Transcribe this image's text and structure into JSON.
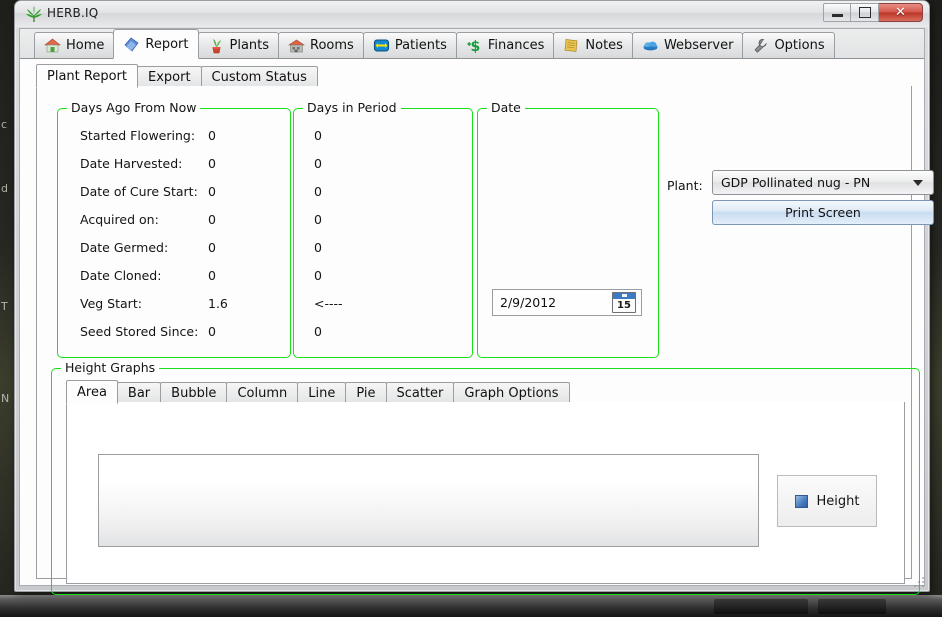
{
  "window": {
    "title": "HERB.IQ",
    "app_icon": "cannabis-leaf-icon",
    "minimize_label": "Minimize",
    "maximize_label": "Maximize",
    "close_label": "Close"
  },
  "desktop": {
    "ghost_text": [
      "c",
      "d",
      "T",
      "N"
    ]
  },
  "main_tabs": [
    {
      "label": "Home",
      "icon": "house-icon",
      "active": false
    },
    {
      "label": "Report",
      "icon": "report-icon",
      "active": true
    },
    {
      "label": "Plants",
      "icon": "plant-pot-icon",
      "active": false
    },
    {
      "label": "Rooms",
      "icon": "building-icon",
      "active": false
    },
    {
      "label": "Patients",
      "icon": "patients-icon",
      "active": false
    },
    {
      "label": "Finances",
      "icon": "dollar-icon",
      "active": false
    },
    {
      "label": "Notes",
      "icon": "notebook-icon",
      "active": false
    },
    {
      "label": "Webserver",
      "icon": "cloud-icon",
      "active": false
    },
    {
      "label": "Options",
      "icon": "wrench-icon",
      "active": false
    }
  ],
  "sub_tabs": [
    {
      "label": "Plant Report",
      "active": true
    },
    {
      "label": "Export",
      "active": false
    },
    {
      "label": "Custom Status",
      "active": false
    }
  ],
  "days_ago_group": {
    "title": "Days Ago From Now",
    "rows": [
      {
        "label": "Started Flowering:",
        "value": "0"
      },
      {
        "label": "Date Harvested:",
        "value": "0"
      },
      {
        "label": "Date of Cure Start:",
        "value": "0"
      },
      {
        "label": "Acquired on:",
        "value": "0"
      },
      {
        "label": "Date Germed:",
        "value": "0"
      },
      {
        "label": "Date Cloned:",
        "value": "0"
      },
      {
        "label": "Veg Start:",
        "value": "1.6"
      },
      {
        "label": "Seed Stored Since:",
        "value": "0"
      }
    ]
  },
  "days_in_period_group": {
    "title": "Days in Period",
    "values": [
      "0",
      "0",
      "0",
      "0",
      "0",
      "0",
      "<----",
      "0"
    ]
  },
  "date_group": {
    "title": "Date",
    "value": "2/9/2012",
    "calendar_icon": "calendar-icon",
    "calendar_day": "15"
  },
  "plant_panel": {
    "label": "Plant:",
    "selected": "GDP Pollinated nug - PN",
    "print_button": "Print Screen"
  },
  "height_graphs": {
    "title": "Height Graphs",
    "tabs": [
      {
        "label": "Area",
        "active": true
      },
      {
        "label": "Bar",
        "active": false
      },
      {
        "label": "Bubble",
        "active": false
      },
      {
        "label": "Column",
        "active": false
      },
      {
        "label": "Line",
        "active": false
      },
      {
        "label": "Pie",
        "active": false
      },
      {
        "label": "Scatter",
        "active": false
      },
      {
        "label": "Graph Options",
        "active": false
      }
    ],
    "legend": {
      "label": "Height",
      "color": "#3e6fae"
    }
  },
  "chart_data": {
    "type": "area",
    "title": "Height Graphs",
    "series": [
      {
        "name": "Height",
        "values": [],
        "color": "#3e6fae"
      }
    ],
    "categories": [],
    "xlabel": "",
    "ylabel": "",
    "grid": false,
    "legend_position": "right",
    "note": "Plot area is empty - no data points rendered"
  }
}
